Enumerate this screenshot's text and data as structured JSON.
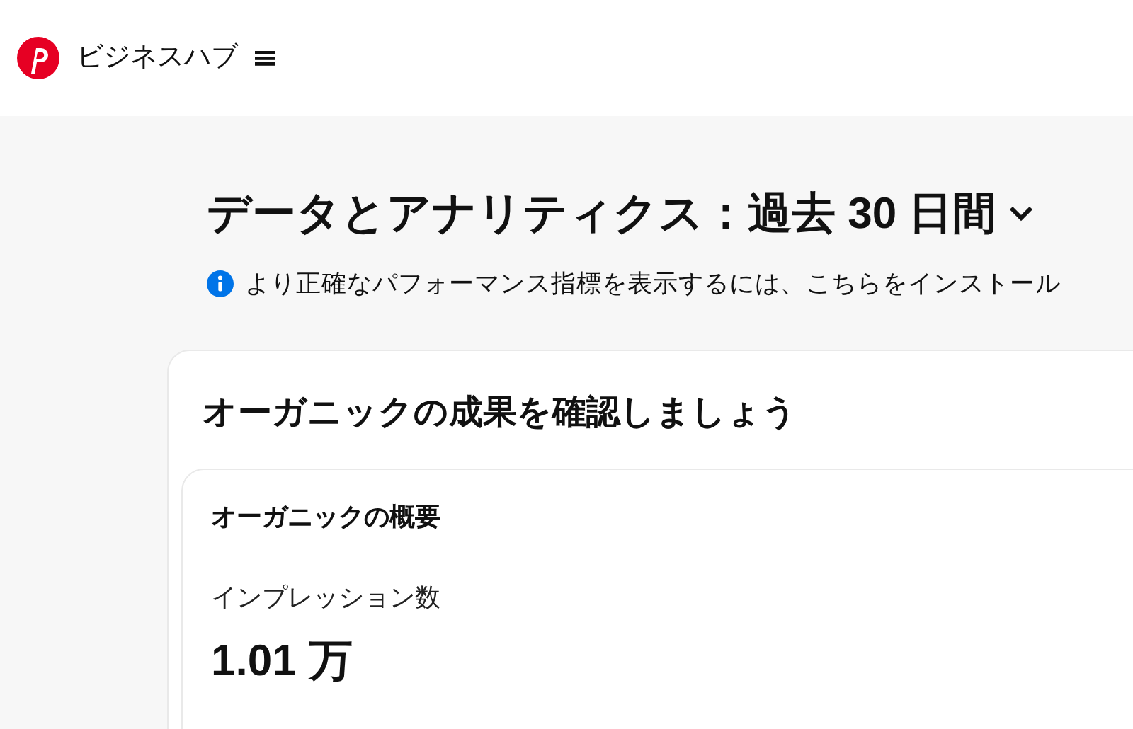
{
  "header": {
    "app_name": "ビジネスハブ"
  },
  "page": {
    "title": "データとアナリティクス：過去 30 日間",
    "info": "より正確なパフォーマンス指標を表示するには、こちらをインストール"
  },
  "card": {
    "title": "オーガニックの成果を確認しましょう",
    "overview": {
      "title": "オーガニックの概要",
      "metric_label": "インプレッション数",
      "metric_value": "1.01 万"
    }
  }
}
